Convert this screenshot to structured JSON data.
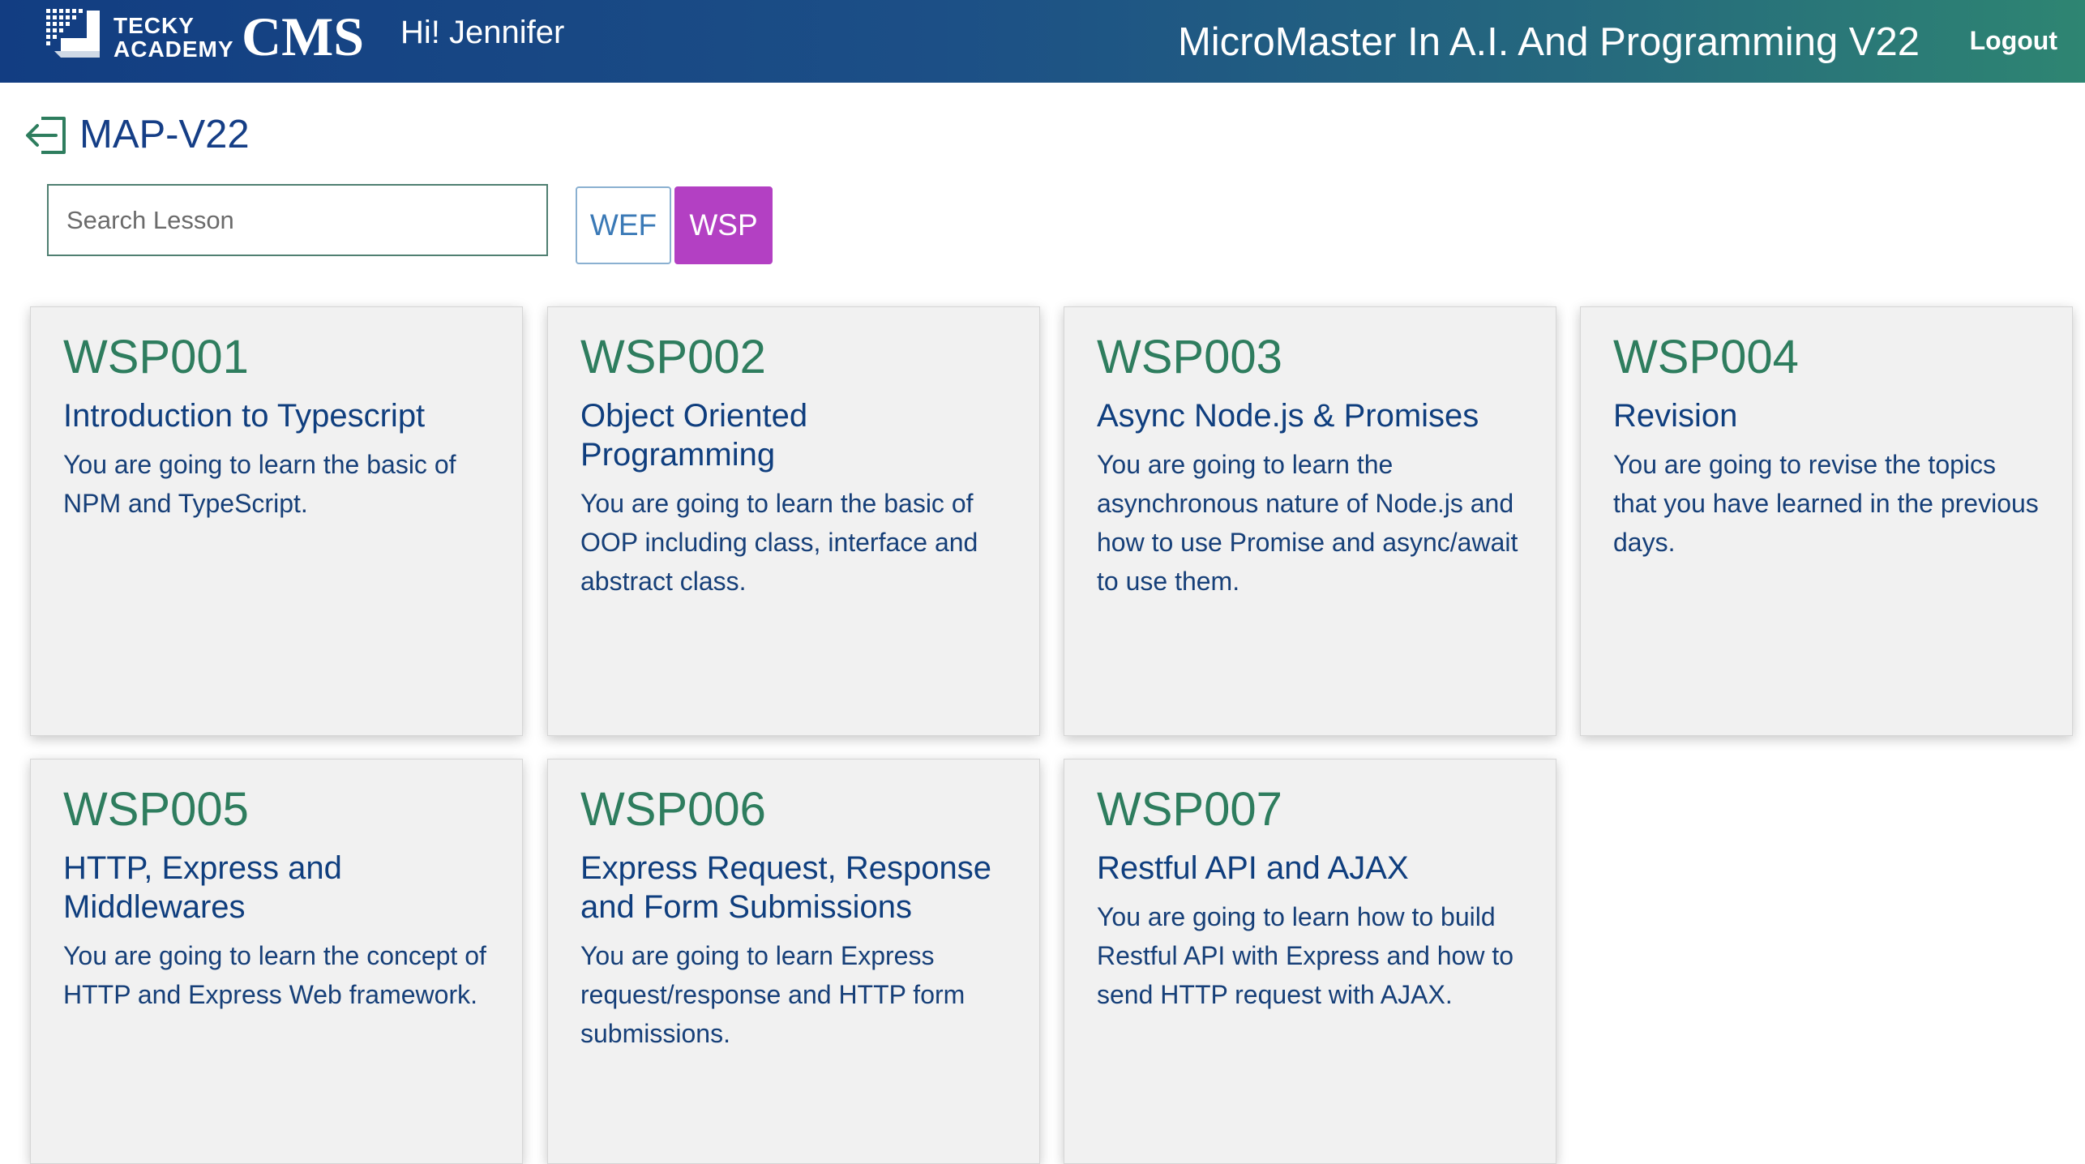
{
  "header": {
    "logo_line1": "TECKY",
    "logo_line2": "ACADEMY",
    "logo_cms": "CMS",
    "greeting": "Hi! Jennifer",
    "course_title": "MicroMaster In A.I. And Programming V22",
    "logout_label": "Logout"
  },
  "page": {
    "title": "MAP-V22",
    "back_icon": "back-arrow-icon",
    "search_placeholder": "Search Lesson",
    "search_value": ""
  },
  "filters": [
    {
      "label": "WEF",
      "active": false,
      "color": "#3a79b6"
    },
    {
      "label": "WSP",
      "active": true,
      "color": "#b340c3"
    }
  ],
  "colors": {
    "header_gradient_start": "#123d82",
    "header_gradient_end": "#2e8572",
    "lesson_code": "#2e7d5e",
    "lesson_title": "#0f3e7e",
    "card_bg": "#f1f1f1"
  },
  "lessons": [
    {
      "code": "WSP001",
      "title": "Introduction to Typescript",
      "description": "You are going to learn the basic of NPM and TypeScript."
    },
    {
      "code": "WSP002",
      "title": "Object Oriented Programming",
      "description": "You are going to learn the basic of OOP including class, interface and abstract class."
    },
    {
      "code": "WSP003",
      "title": "Async Node.js & Promises",
      "description": "You are going to learn the asynchronous nature of Node.js and how to use Promise and async/await to use them."
    },
    {
      "code": "WSP004",
      "title": "Revision",
      "description": "You are going to revise the topics that you have learned in the previous days."
    },
    {
      "code": "WSP005",
      "title": "HTTP, Express and Middlewares",
      "description": "You are going to learn the concept of HTTP and Express Web framework."
    },
    {
      "code": "WSP006",
      "title": "Express Request, Response and Form Submissions",
      "description": "You are going to learn Express request/response and HTTP form submissions."
    },
    {
      "code": "WSP007",
      "title": "Restful API and AJAX",
      "description": "You are going to learn how to build Restful API with Express and how to send HTTP request with AJAX."
    }
  ]
}
